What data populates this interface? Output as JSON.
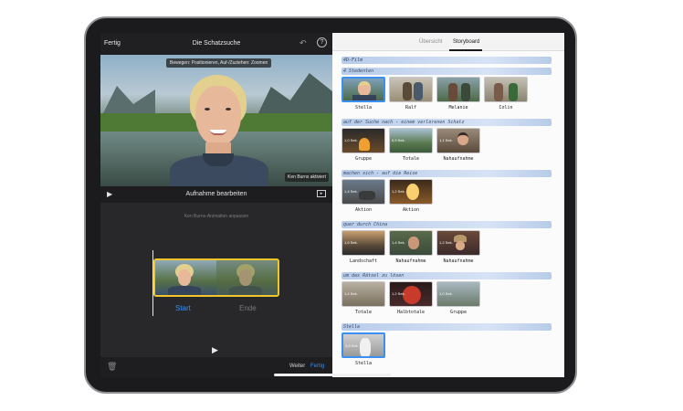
{
  "left": {
    "top_left": "Fertig",
    "title": "Die Schatzsuche",
    "hint": "Bewegen: Positionieren, Auf-/Zuziehen: Zoomen",
    "ken_burns_tag": "Ken Burns aktiviert",
    "control_title": "Aufnahme bearbeiten",
    "ken_burns_sub": "Ken Burns-Animation anpassen",
    "start": "Start",
    "ende": "Ende",
    "weiter": "Weiter",
    "fertig": "Fertig"
  },
  "right": {
    "tabs": [
      "Übersicht",
      "Storyboard"
    ],
    "sections": [
      "4D-Film",
      "4 Stedenten",
      "auf der Suche nach - einem verlorenen Schatz",
      "machen sich - auf die Reise",
      "quer durch China",
      "um das Rätsel zu lösen",
      "Stella"
    ],
    "clips": [
      {
        "label": "Stella",
        "dur": ""
      },
      {
        "label": "Ralf",
        "dur": ""
      },
      {
        "label": "Melanie",
        "dur": ""
      },
      {
        "label": "Colin",
        "dur": ""
      },
      {
        "label": "Gruppe",
        "dur": "1,0 Sek."
      },
      {
        "label": "Totale",
        "dur": "0,9 Sek."
      },
      {
        "label": "Nahaufnahme",
        "dur": "1,1 Sek."
      },
      {
        "label": "Aktion",
        "dur": "1,4 Sek."
      },
      {
        "label": "Aktion",
        "dur": "1,2 Sek."
      },
      {
        "label": "Landschaft",
        "dur": "1,6 Sek."
      },
      {
        "label": "Nahaufnahme",
        "dur": "1,4 Sek."
      },
      {
        "label": "Nahaufnahme",
        "dur": "1,2 Sek."
      },
      {
        "label": "Totale",
        "dur": "1,4 Sek."
      },
      {
        "label": "Halbtotale",
        "dur": "1,2 Sek."
      },
      {
        "label": "Gruppe",
        "dur": "1,0 Sek."
      },
      {
        "label": "Stella",
        "dur": "3,6 Sek."
      }
    ]
  }
}
